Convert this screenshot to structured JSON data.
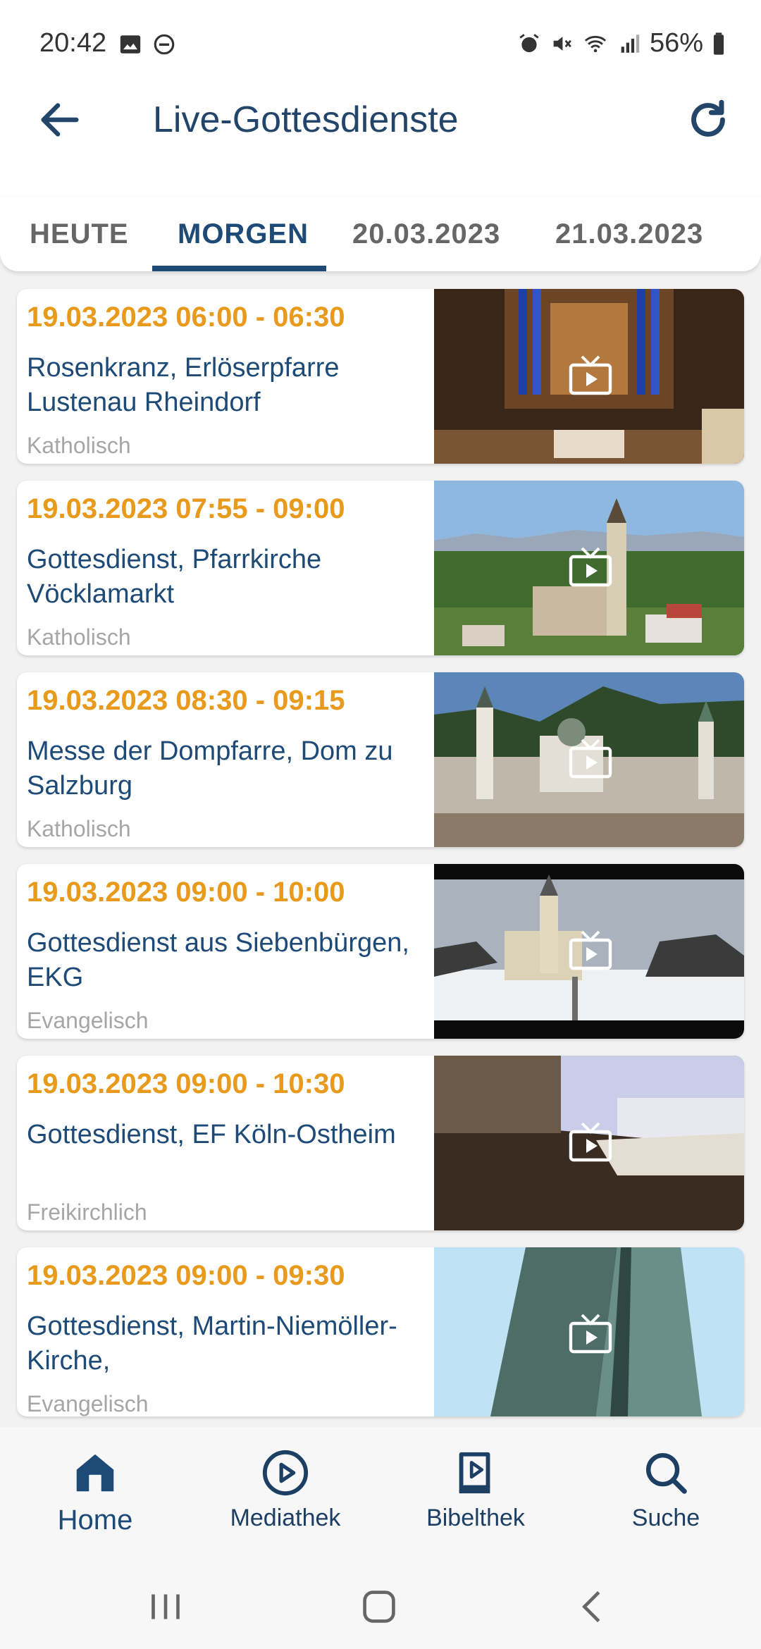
{
  "status_bar": {
    "time": "20:42",
    "battery": "56%",
    "left_icons": [
      "image-icon",
      "dnd-icon"
    ],
    "right_icons": [
      "alarm-icon",
      "mute-icon",
      "wifi-icon",
      "signal-icon",
      "battery-icon"
    ]
  },
  "app_bar": {
    "title": "Live-Gottesdienste",
    "back_icon": "arrow-left-icon",
    "refresh_icon": "refresh-icon"
  },
  "tabs": [
    {
      "label": "HEUTE",
      "active": false
    },
    {
      "label": "MORGEN",
      "active": true
    },
    {
      "label": "20.03.2023",
      "active": false
    },
    {
      "label": "21.03.2023",
      "active": false
    }
  ],
  "items": [
    {
      "time": "19.03.2023 06:00 - 06:30",
      "title": "Rosenkranz, Erlöserpfarre Lustenau Rheindorf",
      "category": "Katholisch"
    },
    {
      "time": "19.03.2023 07:55 - 09:00",
      "title": "Gottesdienst, Pfarrkirche Vöcklamarkt",
      "category": "Katholisch"
    },
    {
      "time": "19.03.2023 08:30 - 09:15",
      "title": "Messe der Dompfarre, Dom zu Salzburg",
      "category": "Katholisch"
    },
    {
      "time": "19.03.2023 09:00 - 10:00",
      "title": "Gottesdienst aus Siebenbürgen, EKG",
      "category": "Evangelisch"
    },
    {
      "time": "19.03.2023 09:00 - 10:30",
      "title": "Gottesdienst, EF Köln-Ostheim",
      "category": "Freikirchlich"
    },
    {
      "time": "19.03.2023 09:00 - 09:30",
      "title": "Gottesdienst, Martin-Niemöller-Kirche,",
      "category": "Evangelisch"
    }
  ],
  "bottom_nav": [
    {
      "label": "Home",
      "icon": "home-icon",
      "active": true
    },
    {
      "label": "Mediathek",
      "icon": "play-circle-icon",
      "active": false
    },
    {
      "label": "Bibelthek",
      "icon": "bible-icon",
      "active": false
    },
    {
      "label": "Suche",
      "icon": "search-icon",
      "active": false
    }
  ],
  "colors": {
    "primary": "#1d4a76",
    "accent_time": "#e89a1c",
    "category_grey": "#a6a6a6"
  }
}
